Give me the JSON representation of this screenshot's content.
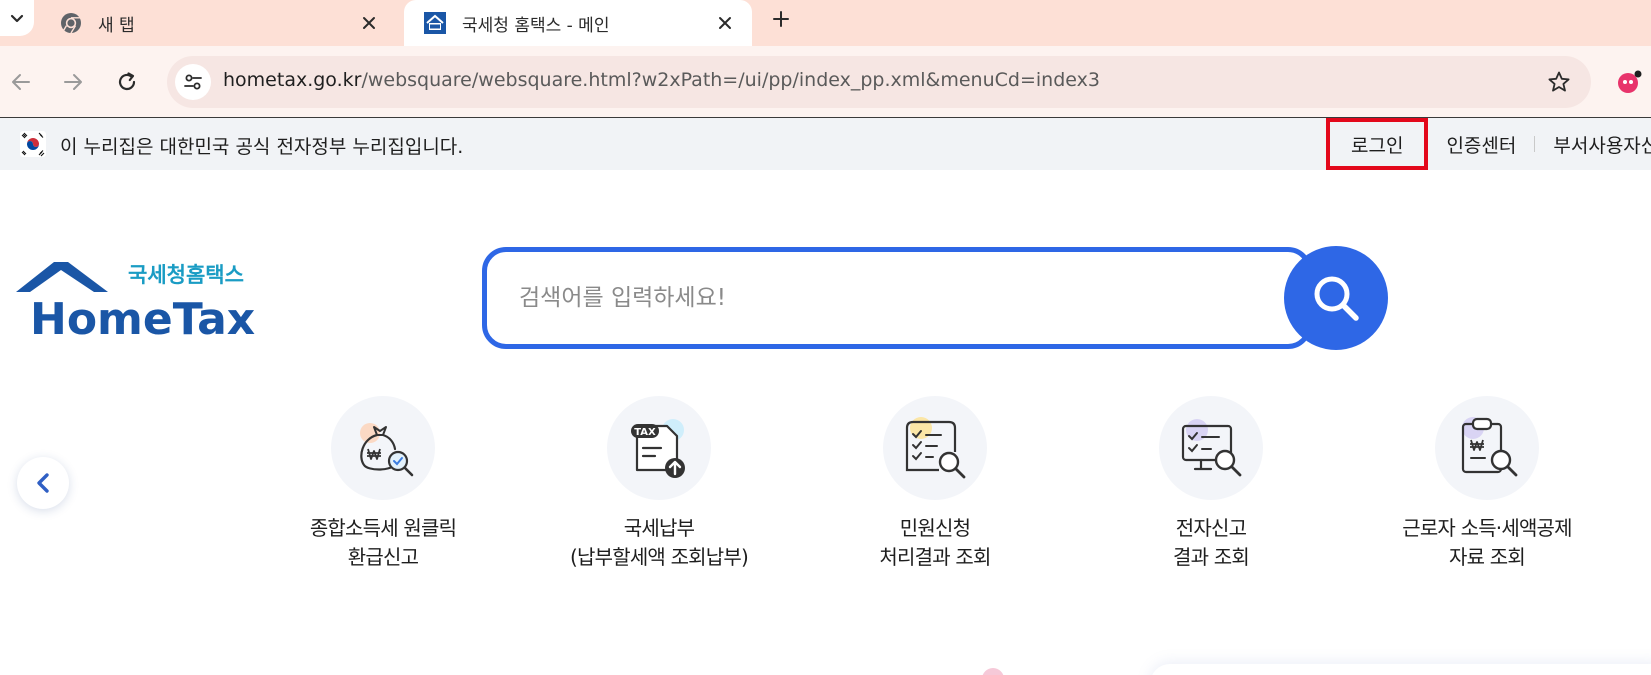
{
  "browser": {
    "tabs": [
      {
        "title": "새 탭",
        "active": false,
        "favicon": "chrome-icon"
      },
      {
        "title": "국세청 홈택스 - 메인",
        "active": true,
        "favicon": "hometax-favicon"
      }
    ],
    "url_host": "hometax.go.kr",
    "url_path": "/websquare/websquare.html?w2xPath=/ui/pp/index_pp.xml&menuCd=index3"
  },
  "gov_banner": {
    "text": "이 누리집은 대한민국 공식 전자정부 누리집입니다.",
    "links": [
      "로그인",
      "인증센터",
      "부서사용자신청"
    ]
  },
  "logo": {
    "korean": "국세청홈택스",
    "english": "HomeTax",
    "color_dark": "#1a56a6",
    "color_light": "#1a9cc4"
  },
  "search": {
    "placeholder": "검색어를 입력하세요!",
    "accent": "#2e67e6"
  },
  "quick_menu": [
    {
      "line1": "종합소득세 원클릭",
      "line2": "환급신고",
      "icon": "money-bag-search-icon"
    },
    {
      "line1": "국세납부",
      "line2": "(납부할세액 조회납부)",
      "icon": "tax-document-upload-icon"
    },
    {
      "line1": "민원신청",
      "line2": "처리결과 조회",
      "icon": "checklist-search-icon"
    },
    {
      "line1": "전자신고",
      "line2": "결과 조회",
      "icon": "monitor-search-icon"
    },
    {
      "line1": "근로자 소득·세액공제",
      "line2": "자료 조회",
      "icon": "clipboard-search-icon"
    }
  ],
  "highlight_color": "#e3081b"
}
